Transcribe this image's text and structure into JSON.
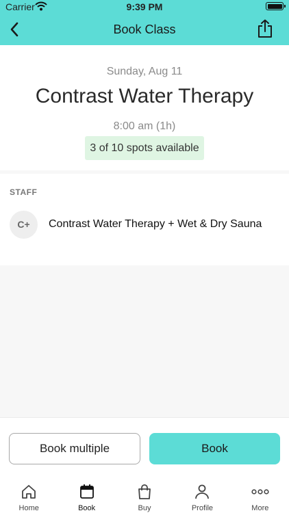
{
  "status_bar": {
    "carrier": "Carrier",
    "time": "9:39 PM"
  },
  "nav": {
    "title": "Book Class",
    "back_icon": "chevron-left-icon",
    "share_icon": "share-icon"
  },
  "class_info": {
    "date": "Sunday, Aug 11",
    "name": "Contrast Water Therapy",
    "time": "8:00 am (1h)",
    "spots": "3 of 10 spots available"
  },
  "staff": {
    "label": "STAFF",
    "items": [
      {
        "initials": "C+",
        "name": "Contrast Water Therapy + Wet & Dry Sauna"
      }
    ]
  },
  "actions": {
    "book_multiple": "Book multiple",
    "book": "Book"
  },
  "tabs": [
    {
      "label": "Home",
      "icon": "home-icon"
    },
    {
      "label": "Book",
      "icon": "calendar-icon",
      "active": true
    },
    {
      "label": "Buy",
      "icon": "shopping-bag-icon"
    },
    {
      "label": "Profile",
      "icon": "profile-icon"
    },
    {
      "label": "More",
      "icon": "more-icon"
    }
  ],
  "colors": {
    "accent": "#5cdcd6",
    "spots_bg": "#dff5e3"
  }
}
